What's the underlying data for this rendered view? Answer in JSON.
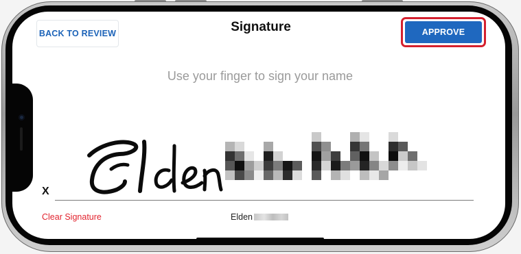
{
  "header": {
    "back_label": "BACK TO REVIEW",
    "title": "Signature",
    "approve_label": "APPROVE"
  },
  "signature": {
    "instruction": "Use your finger to sign your name",
    "x_mark": "X",
    "clear_label": "Clear Signature",
    "signer_first_name": "Elden"
  },
  "colors": {
    "accent": "#1f68bf",
    "highlight": "#d4202e",
    "danger_text": "#e2232e"
  }
}
